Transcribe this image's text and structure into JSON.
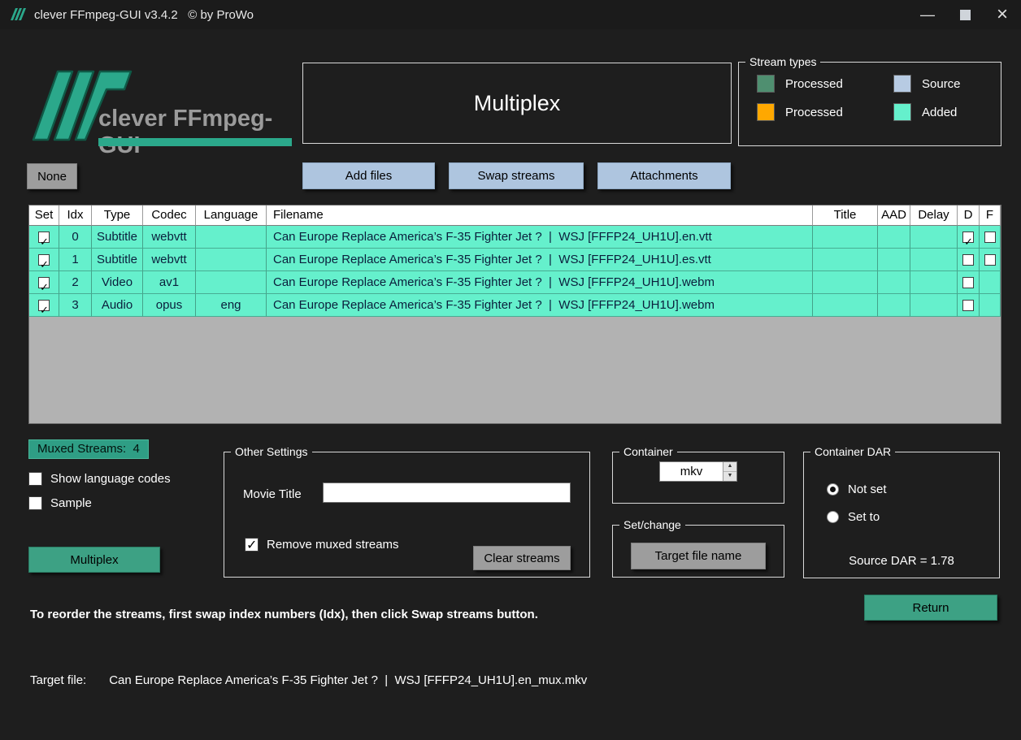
{
  "window": {
    "title": "clever FFmpeg-GUI v3.4.2   © by ProWo"
  },
  "logo": {
    "text": "clever FFmpeg-GUI"
  },
  "mode_panel": {
    "title": "Multiplex"
  },
  "stream_types": {
    "title": "Stream types",
    "items": [
      {
        "label": "Processed",
        "color": "#4f8f70"
      },
      {
        "label": "Source",
        "color": "#b7cbe3"
      },
      {
        "label": "Processed",
        "color": "#ffa800"
      },
      {
        "label": "Added",
        "color": "#65f0cc"
      }
    ]
  },
  "toolbar": {
    "none": "None",
    "add_files": "Add files",
    "swap_streams": "Swap streams",
    "attachments": "Attachments"
  },
  "table": {
    "headers": [
      "Set",
      "Idx",
      "Type",
      "Codec",
      "Language",
      "Filename",
      "Title",
      "AAD",
      "Delay",
      "D",
      "F"
    ],
    "rows": [
      {
        "set": true,
        "idx": "0",
        "type": "Subtitle",
        "codec": "webvtt",
        "language": "",
        "filename": "Can Europe Replace America’s F-35 Fighter Jet ?  |  WSJ [FFFP24_UH1U].en.vtt",
        "title": "",
        "aad": "",
        "delay": "",
        "d": true,
        "f": false
      },
      {
        "set": true,
        "idx": "1",
        "type": "Subtitle",
        "codec": "webvtt",
        "language": "",
        "filename": "Can Europe Replace America’s F-35 Fighter Jet ?  |  WSJ [FFFP24_UH1U].es.vtt",
        "title": "",
        "aad": "",
        "delay": "",
        "d": false,
        "f": false
      },
      {
        "set": true,
        "idx": "2",
        "type": "Video",
        "codec": "av1",
        "language": "",
        "filename": "Can Europe Replace America’s F-35 Fighter Jet ?  |  WSJ [FFFP24_UH1U].webm",
        "title": "",
        "aad": "",
        "delay": "",
        "d": false,
        "f": null
      },
      {
        "set": true,
        "idx": "3",
        "type": "Audio",
        "codec": "opus",
        "language": "eng",
        "filename": "Can Europe Replace America’s F-35 Fighter Jet ?  |  WSJ [FFFP24_UH1U].webm",
        "title": "",
        "aad": "",
        "delay": "",
        "d": false,
        "f": null
      }
    ]
  },
  "left_panel": {
    "muxed_streams": "Muxed Streams:  4",
    "show_language_codes": "Show language codes",
    "sample": "Sample",
    "multiplex_button": "Multiplex"
  },
  "other_settings": {
    "title": "Other Settings",
    "movie_title_label": "Movie Title",
    "movie_title_value": "",
    "remove_muxed_streams": "Remove muxed streams",
    "remove_muxed_checked": true,
    "clear_streams": "Clear streams"
  },
  "container": {
    "title": "Container",
    "value": "mkv"
  },
  "set_change": {
    "title": "Set/change",
    "target_file_name": "Target file name"
  },
  "container_dar": {
    "title": "Container DAR",
    "not_set": "Not set",
    "set_to": "Set to",
    "selected": "Not set",
    "source_dar": "Source DAR = 1.78"
  },
  "footer": {
    "instruction": "To reorder the streams, first swap index numbers (Idx), then click Swap streams button.",
    "target_file_label": "Target file:",
    "target_file_value": "Can Europe Replace America’s F-35 Fighter Jet ?  |  WSJ [FFFP24_UH1U].en_mux.mkv",
    "return_button": "Return"
  }
}
